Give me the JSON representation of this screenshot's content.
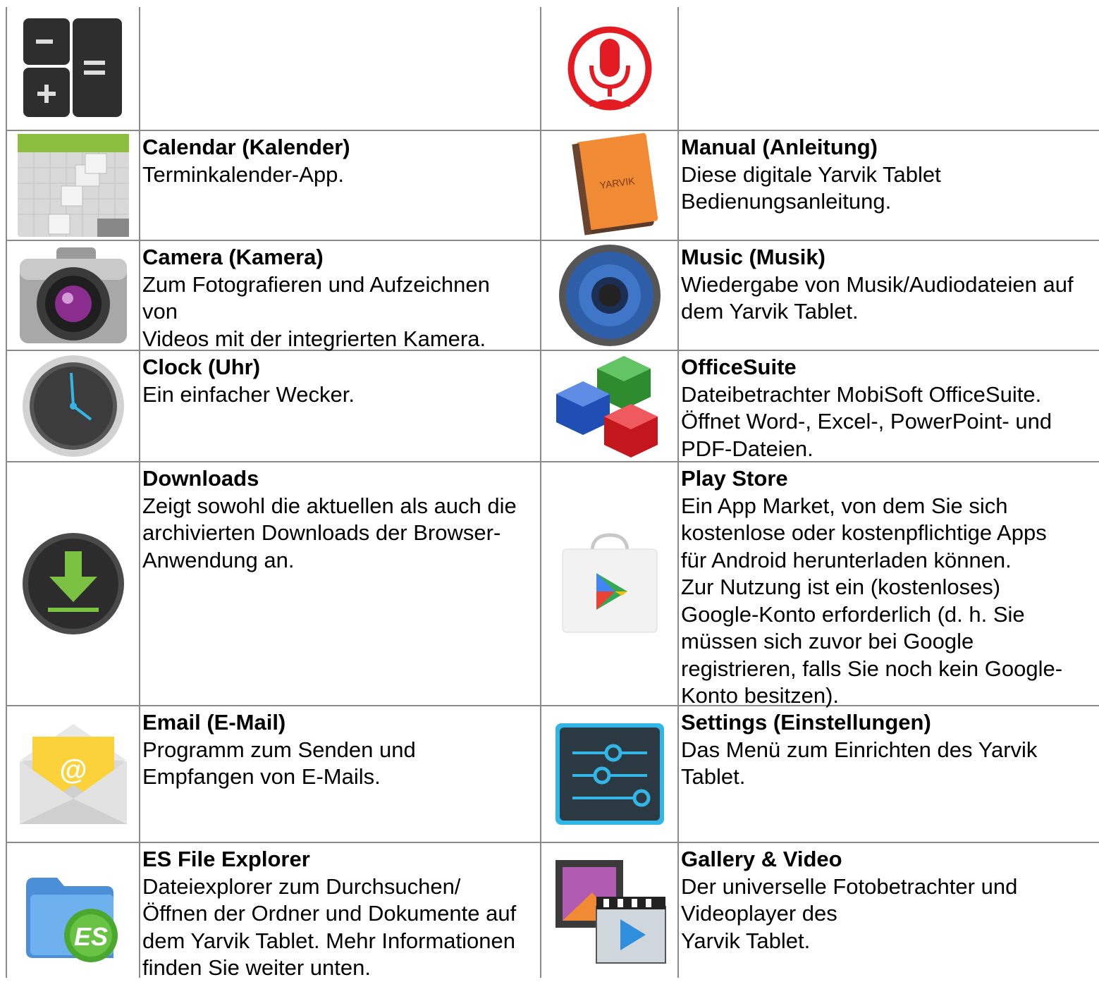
{
  "rows": [
    {
      "left": {
        "icon": "calculator-icon",
        "title": "",
        "lines": []
      },
      "right": {
        "icon": "voice-search-icon",
        "title": "",
        "lines": []
      }
    },
    {
      "left": {
        "icon": "calendar-icon",
        "title": "Calendar (Kalender)",
        "lines": [
          "Terminkalender-App."
        ]
      },
      "right": {
        "icon": "manual-book-icon",
        "title": "Manual (Anleitung)",
        "lines": [
          "Diese digitale Yarvik Tablet",
          "Bedienungsanleitung."
        ],
        "icon_text": "YARVIK"
      }
    },
    {
      "left": {
        "icon": "camera-icon",
        "title": "Camera (Kamera)",
        "lines": [
          "Zum Fotografieren und Aufzeichnen",
          "von",
          "Videos mit der integrierten Kamera."
        ]
      },
      "right": {
        "icon": "music-speaker-icon",
        "title": "Music (Musik)",
        "lines": [
          "Wiedergabe von Musik/Audiodateien auf",
          "dem Yarvik Tablet."
        ]
      }
    },
    {
      "left": {
        "icon": "clock-icon",
        "title": "Clock (Uhr)",
        "lines": [
          "Ein einfacher Wecker."
        ]
      },
      "right": {
        "icon": "officesuite-cubes-icon",
        "title": "OfficeSuite",
        "lines": [
          "Dateibetrachter MobiSoft OfficeSuite.",
          "Öffnet Word-, Excel-, PowerPoint- und",
          "PDF-Dateien."
        ]
      }
    },
    {
      "left": {
        "icon": "downloads-icon",
        "title": "Downloads",
        "lines": [
          "Zeigt sowohl die aktuellen als auch die",
          "archivierten Downloads der Browser-",
          "Anwendung an."
        ]
      },
      "right": {
        "icon": "play-store-icon",
        "title": "Play Store",
        "lines": [
          "Ein App Market, von dem Sie sich",
          "kostenlose oder kostenpflichtige Apps",
          "für Android herunterladen können.",
          "Zur Nutzung ist ein (kostenloses)",
          "Google-Konto erforderlich (d. h. Sie",
          "müssen sich zuvor bei Google",
          "registrieren, falls Sie noch kein Google-",
          "Konto besitzen)."
        ]
      }
    },
    {
      "left": {
        "icon": "email-icon",
        "title": "Email (E-Mail)",
        "lines": [
          "Programm zum Senden und",
          "Empfangen von E-Mails."
        ]
      },
      "right": {
        "icon": "settings-sliders-icon",
        "title": "Settings (Einstellungen)",
        "lines": [
          "Das Menü zum Einrichten des Yarvik",
          "Tablet."
        ]
      }
    },
    {
      "left": {
        "icon": "es-file-explorer-icon",
        "title": "ES File Explorer",
        "lines": [
          "Dateiexplorer zum Durchsuchen/",
          "Öffnen der Ordner und Dokumente auf",
          "dem Yarvik Tablet. Mehr Informationen",
          "finden Sie weiter unten."
        ],
        "icon_text": "ES"
      },
      "right": {
        "icon": "gallery-video-icon",
        "title": "Gallery & Video",
        "lines": [
          "Der universelle Fotobetrachter und",
          "Videoplayer des",
          "Yarvik Tablet."
        ]
      }
    }
  ]
}
